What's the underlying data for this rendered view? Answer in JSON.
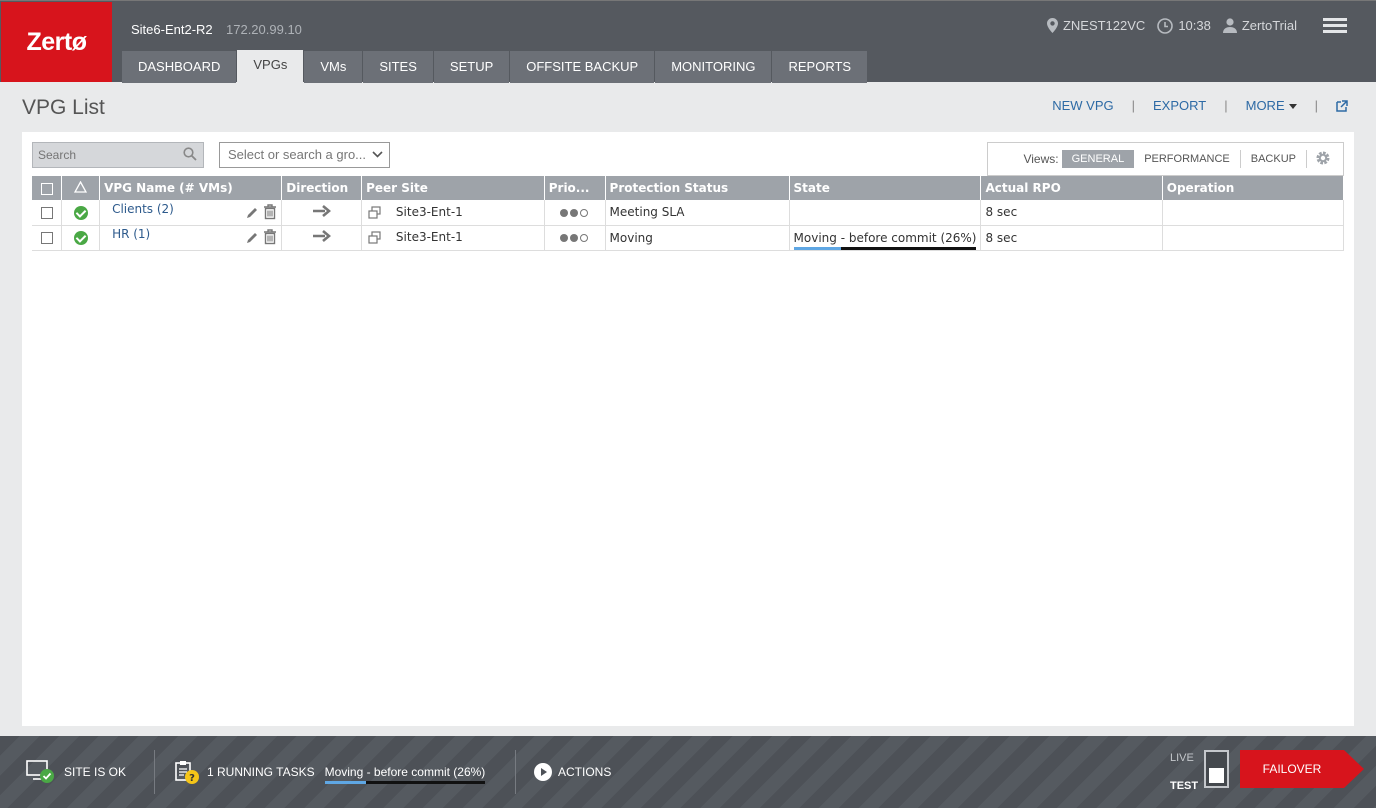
{
  "header": {
    "logo": "Zertø",
    "site_name": "Site6-Ent2-R2",
    "site_ip": "172.20.99.10",
    "tabs": [
      {
        "label": "DASHBOARD",
        "active": false
      },
      {
        "label": "VPGs",
        "active": true
      },
      {
        "label": "VMs",
        "active": false
      },
      {
        "label": "SITES",
        "active": false
      },
      {
        "label": "SETUP",
        "active": false
      },
      {
        "label": "OFFSITE BACKUP",
        "active": false
      },
      {
        "label": "MONITORING",
        "active": false
      },
      {
        "label": "REPORTS",
        "active": false
      }
    ],
    "location": "ZNEST122VC",
    "time": "10:38",
    "user": "ZertoTrial"
  },
  "page": {
    "title": "VPG List",
    "actions": {
      "new_vpg": "NEW VPG",
      "export": "EXPORT",
      "more": "MORE"
    }
  },
  "filters": {
    "search_placeholder": "Search",
    "group_placeholder": "Select or search a gro..."
  },
  "views": {
    "label": "Views:",
    "options": [
      "GENERAL",
      "PERFORMANCE",
      "BACKUP"
    ],
    "active": "GENERAL"
  },
  "table": {
    "columns": [
      "VPG Name (# VMs)",
      "Direction",
      "Peer Site",
      "Prio...",
      "Protection Status",
      "State",
      "Actual RPO",
      "Operation"
    ],
    "rows": [
      {
        "name": "Clients (2)",
        "peer_site": "Site3-Ent-1",
        "priority": 2,
        "protection_status": "Meeting SLA",
        "state": "",
        "state_progress": null,
        "rpo": "8 sec",
        "operation": ""
      },
      {
        "name": "HR (1)",
        "peer_site": "Site3-Ent-1",
        "priority": 2,
        "protection_status": "Moving",
        "state": "Moving - before commit (26%)",
        "state_progress": 0.26,
        "rpo": "8 sec",
        "operation": ""
      }
    ]
  },
  "footer": {
    "site_status": "SITE IS OK",
    "running_tasks": "1 RUNNING TASKS",
    "task_text": "Moving - before commit (26%)",
    "task_progress": 0.26,
    "actions": "ACTIONS",
    "live": "LIVE",
    "test": "TEST",
    "failover": "FAILOVER"
  },
  "colors": {
    "brand_red": "#d7141c",
    "header_bg": "#55595f",
    "ok_green": "#4aa845",
    "progress_blue": "#5fa7e4",
    "link_blue": "#2d6aa5"
  }
}
